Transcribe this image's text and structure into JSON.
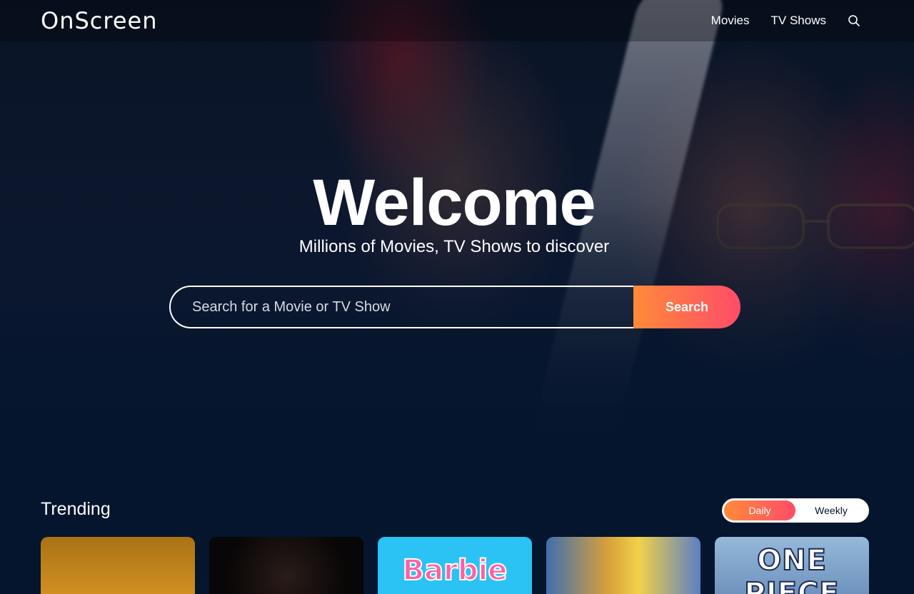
{
  "header": {
    "logo": "OnScreen",
    "nav": [
      {
        "label": "Movies"
      },
      {
        "label": "TV Shows"
      }
    ],
    "search_icon": "search-icon"
  },
  "hero": {
    "title": "Welcome",
    "subtitle": "Millions of Movies, TV Shows to discover",
    "search": {
      "placeholder": "Search for a Movie or TV Show",
      "value": "",
      "button_label": "Search"
    }
  },
  "trending": {
    "title": "Trending",
    "toggle": {
      "options": [
        "Daily",
        "Weekly"
      ],
      "selected": "Daily"
    },
    "cards": [
      {
        "text": ""
      },
      {
        "text": ""
      },
      {
        "text": "Barbie"
      },
      {
        "text": ""
      },
      {
        "text": "ONE PIECE"
      }
    ]
  },
  "colors": {
    "background": "#04152d",
    "accent_gradient_start": "#ff8a38",
    "accent_gradient_end": "#ff4c69"
  }
}
